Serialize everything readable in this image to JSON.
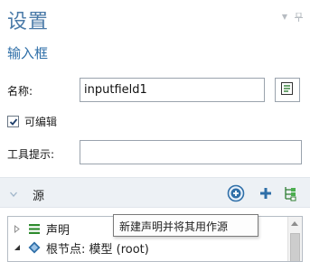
{
  "header": {
    "title": "设置",
    "subtitle": "输入框"
  },
  "form": {
    "name_label": "名称:",
    "name_value": "inputfield1",
    "editable_label": "可编辑",
    "editable_checked": true,
    "tooltip_label": "工具提示:",
    "tooltip_value": ""
  },
  "source_section": {
    "title": "源",
    "icons": [
      "add-source-circle-icon",
      "add-plus-icon",
      "tree-branch-icon"
    ]
  },
  "tree": {
    "items": [
      {
        "label": "声明",
        "icon": "declaration-list-icon",
        "expanded": false
      },
      {
        "label": "根节点: 模型 (root)",
        "icon": "root-model-icon",
        "expanded": true
      }
    ]
  },
  "tooltip": {
    "text": "新建声明并将其用作源"
  },
  "colors": {
    "accent": "#2f6fa8",
    "title": "#4a7aa8",
    "section_bg": "#edf1f5"
  }
}
